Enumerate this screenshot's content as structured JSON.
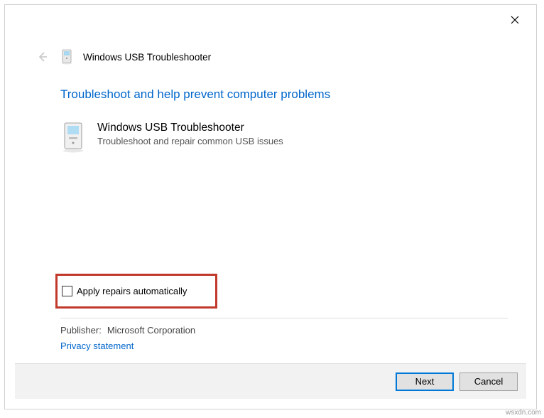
{
  "window": {
    "title": "Windows USB Troubleshooter"
  },
  "main": {
    "heading": "Troubleshoot and help prevent computer problems",
    "item": {
      "title": "Windows USB Troubleshooter",
      "description": "Troubleshoot and repair common USB issues"
    }
  },
  "checkbox": {
    "label": "Apply repairs automatically",
    "checked": false
  },
  "publisher": {
    "label": "Publisher:",
    "value": "Microsoft Corporation"
  },
  "privacy_link": "Privacy statement",
  "buttons": {
    "next": "Next",
    "cancel": "Cancel"
  },
  "watermark": "wsxdn.com"
}
